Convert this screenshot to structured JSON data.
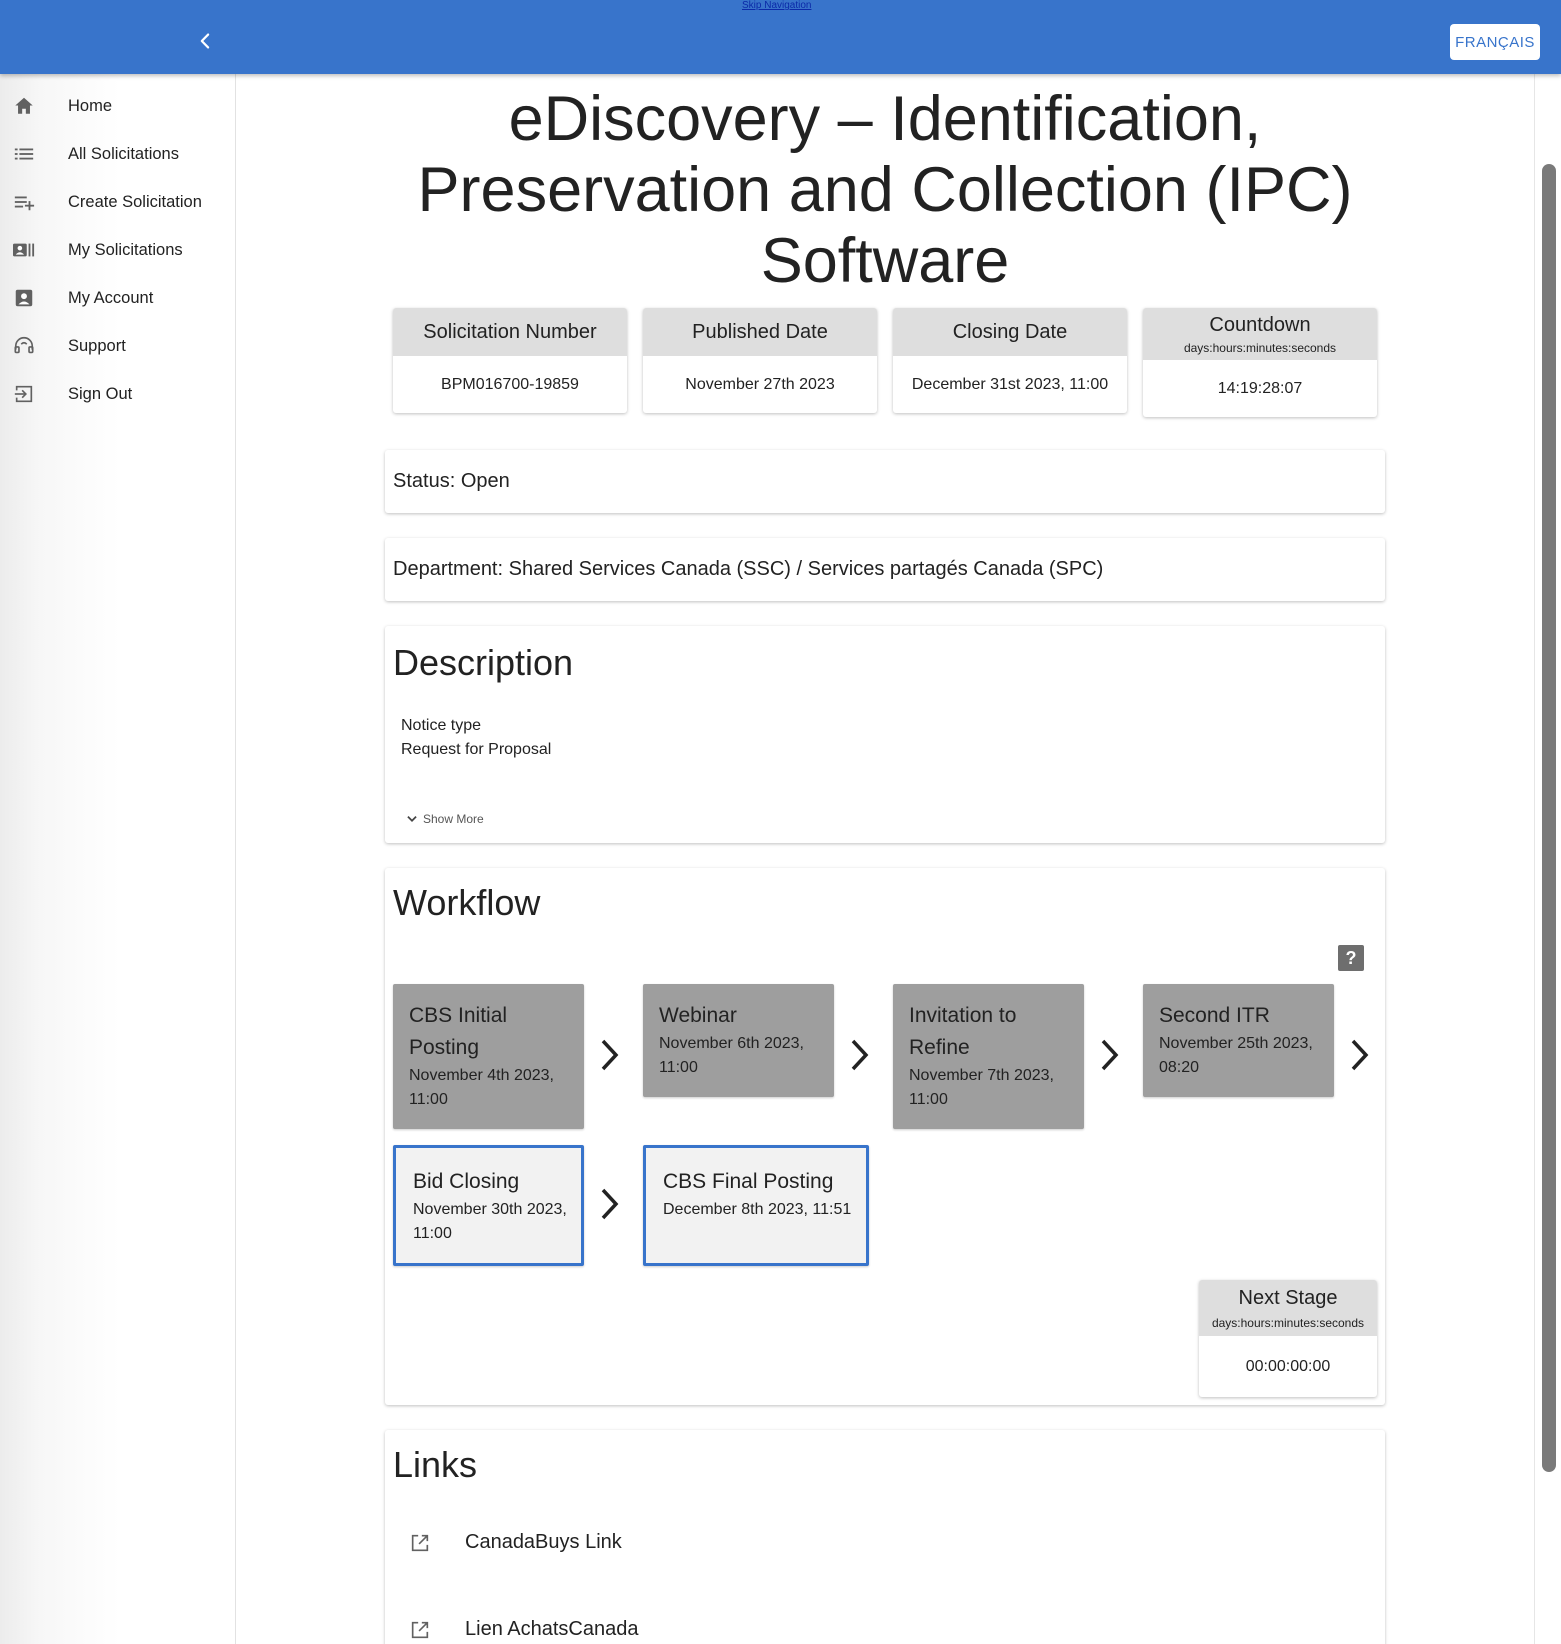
{
  "header": {
    "skip_navigation": "Skip Navigation",
    "language_button": "FRANÇAIS",
    "brand_color": "#3874cb"
  },
  "sidebar": {
    "items": [
      {
        "label": "Home",
        "icon": "home-icon"
      },
      {
        "label": "All Solicitations",
        "icon": "list-icon"
      },
      {
        "label": "Create Solicitation",
        "icon": "playlist-add-icon"
      },
      {
        "label": "My Solicitations",
        "icon": "contact-list-icon"
      },
      {
        "label": "My Account",
        "icon": "account-box-icon"
      },
      {
        "label": "Support",
        "icon": "support-icon"
      },
      {
        "label": "Sign Out",
        "icon": "sign-out-icon"
      }
    ]
  },
  "page": {
    "title": "eDiscovery – Identification, Preservation and Collection (IPC) Software"
  },
  "info_boxes": [
    {
      "label": "Solicitation Number",
      "value": "BPM016700-19859"
    },
    {
      "label": "Published Date",
      "value": "November 27th 2023"
    },
    {
      "label": "Closing Date",
      "value": "December 31st 2023, 11:00"
    },
    {
      "label": "Countdown",
      "sublabel": "days:hours:minutes:seconds",
      "value": "14:19:28:07"
    }
  ],
  "status": {
    "text": "Status: Open"
  },
  "department": {
    "text": "Department: Shared Services Canada (SSC) / Services partagés Canada (SPC)"
  },
  "description": {
    "heading": "Description",
    "lines": [
      "Notice type",
      "Request for Proposal"
    ],
    "show_more": "Show More"
  },
  "workflow": {
    "heading": "Workflow",
    "help": "?",
    "stages": [
      {
        "name": "CBS Initial Posting",
        "date": "November 4th 2023, 11:00",
        "state": "completed"
      },
      {
        "name": "Webinar",
        "date": "November 6th 2023, 11:00",
        "state": "completed"
      },
      {
        "name": "Invitation to Refine",
        "date": "November 7th 2023, 11:00",
        "state": "completed"
      },
      {
        "name": "Second ITR",
        "date": "November 25th 2023, 08:20",
        "state": "completed"
      },
      {
        "name": "Bid Closing",
        "date": "November 30th 2023, 11:00",
        "state": "current"
      },
      {
        "name": "CBS Final Posting",
        "date": "December 8th 2023, 11:51",
        "state": "current"
      }
    ],
    "next_stage": {
      "label": "Next Stage",
      "sublabel": "days:hours:minutes:seconds",
      "value": "00:00:00:00"
    }
  },
  "links": {
    "heading": "Links",
    "items": [
      {
        "label": "CanadaBuys Link",
        "icon": "open-in-new-icon"
      },
      {
        "label": "Lien AchatsCanada",
        "icon": "open-in-new-icon"
      }
    ]
  }
}
